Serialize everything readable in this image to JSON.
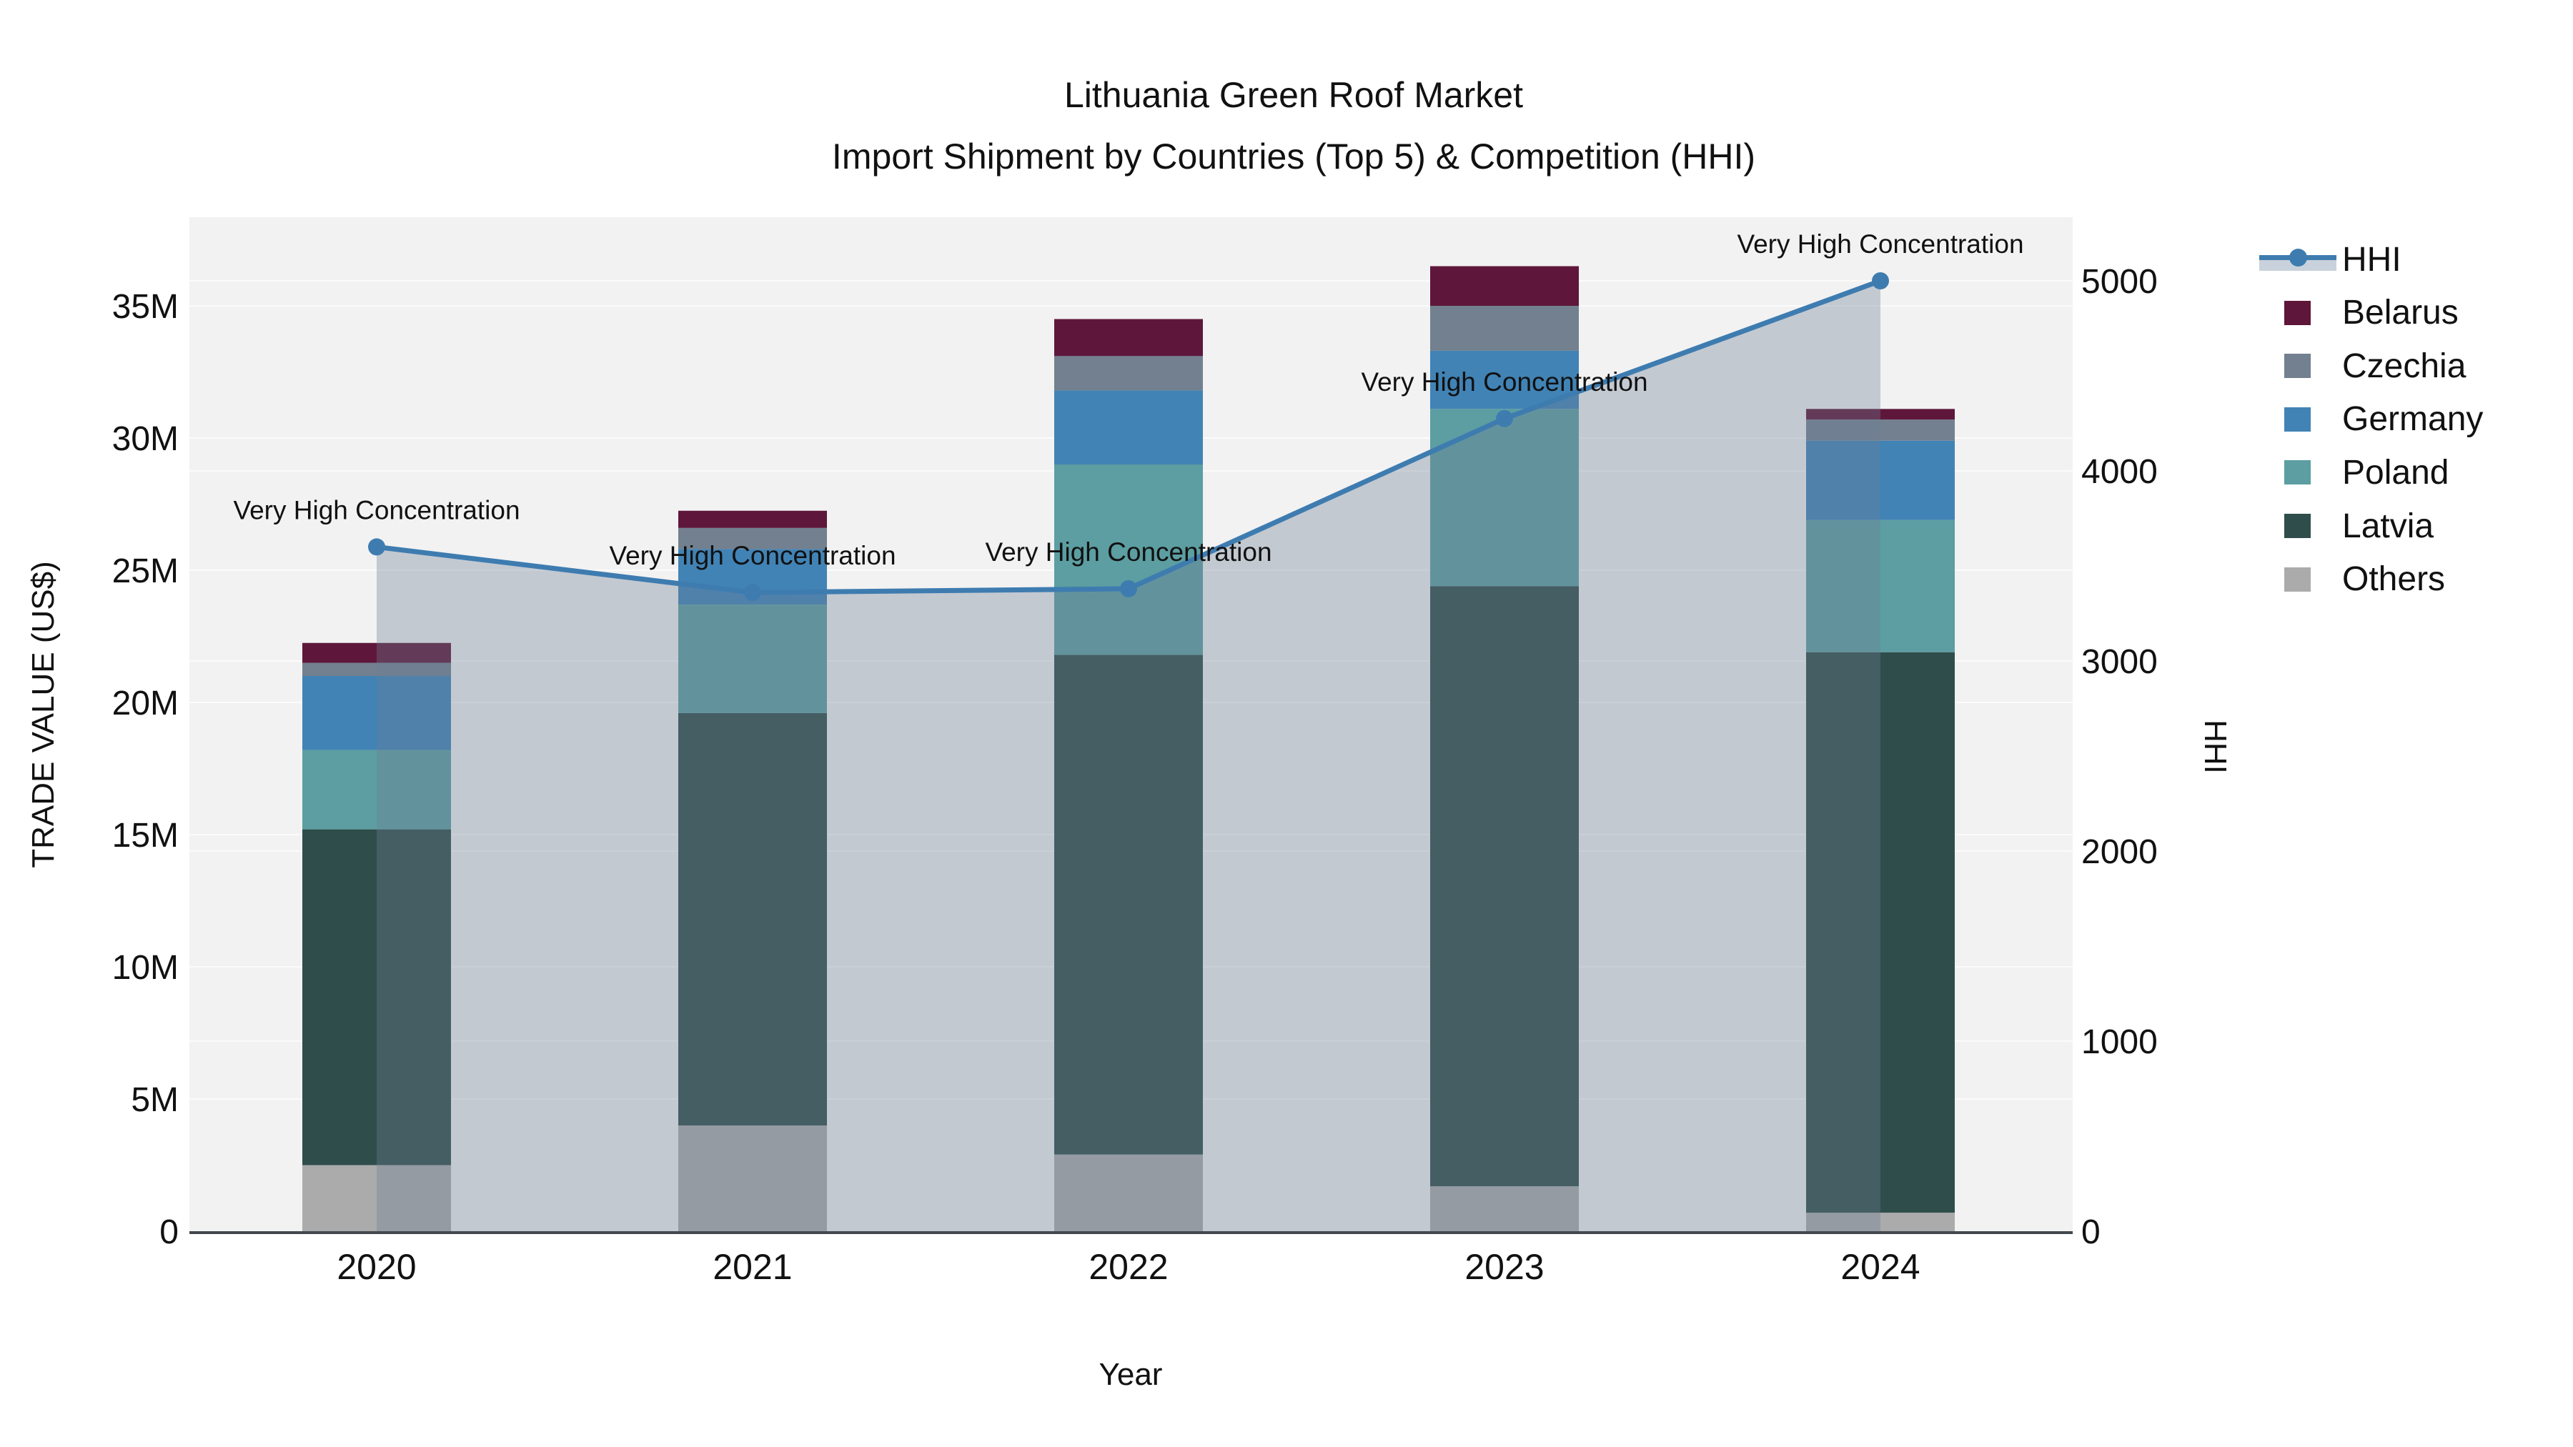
{
  "title": "Lithuania Green Roof Market",
  "subtitle": "Import Shipment by Countries (Top 5) & Competition (HHI)",
  "chart_data": {
    "type": "bar",
    "subtype": "stacked-bars-with-line-overlay",
    "categories": [
      "2020",
      "2021",
      "2022",
      "2023",
      "2024"
    ],
    "xlabel": "Year",
    "ylabel_left": "TRADE VALUE (US$)",
    "ylabel_right": "HHI",
    "ylim_left_musd": [
      0,
      38.3
    ],
    "ylim_right": [
      0,
      5335
    ],
    "grid": true,
    "legend_position": "right",
    "stack_note": "series listed bottom-to-top of the stack; values in millions of US$",
    "series": [
      {
        "name": "Others",
        "color": "#ABABAB",
        "values_musd": [
          2.5,
          4.0,
          2.9,
          1.7,
          0.7
        ]
      },
      {
        "name": "Latvia",
        "color": "#2F4D4B",
        "values_musd": [
          12.7,
          15.6,
          18.9,
          22.7,
          21.2
        ]
      },
      {
        "name": "Poland",
        "color": "#5C9EA1",
        "values_musd": [
          3.0,
          4.1,
          7.2,
          6.7,
          5.0
        ]
      },
      {
        "name": "Germany",
        "color": "#4183B5",
        "values_musd": [
          2.8,
          2.1,
          2.8,
          2.2,
          3.0
        ]
      },
      {
        "name": "Czechia",
        "color": "#72808F",
        "values_musd": [
          0.5,
          0.8,
          1.3,
          1.7,
          0.8
        ]
      },
      {
        "name": "Belarus",
        "color": "#5E173A",
        "values_musd": [
          0.75,
          0.65,
          1.4,
          1.5,
          0.4
        ]
      }
    ],
    "bar_totals_musd": [
      22.25,
      27.25,
      34.5,
      36.5,
      31.1
    ],
    "hhi_line": {
      "name": "HHI",
      "color": "#3E7CB0",
      "area_fill": "rgba(108,125,149,0.35)",
      "values": [
        3600,
        3360,
        3380,
        4275,
        5000
      ]
    },
    "annotations": [
      {
        "x": "2020",
        "text": "Very High Concentration"
      },
      {
        "x": "2021",
        "text": "Very High Concentration"
      },
      {
        "x": "2022",
        "text": "Very High Concentration"
      },
      {
        "x": "2023",
        "text": "Very High Concentration"
      },
      {
        "x": "2024",
        "text": "Very High Concentration"
      }
    ],
    "yaxis_left_ticks": [
      {
        "value": 0,
        "label": "0"
      },
      {
        "value": 5,
        "label": "5M"
      },
      {
        "value": 10,
        "label": "10M"
      },
      {
        "value": 15,
        "label": "15M"
      },
      {
        "value": 20,
        "label": "20M"
      },
      {
        "value": 25,
        "label": "25M"
      },
      {
        "value": 30,
        "label": "30M"
      },
      {
        "value": 35,
        "label": "35M"
      }
    ],
    "yaxis_right_ticks": [
      {
        "value": 0,
        "label": "0"
      },
      {
        "value": 1000,
        "label": "1000"
      },
      {
        "value": 2000,
        "label": "2000"
      },
      {
        "value": 3000,
        "label": "3000"
      },
      {
        "value": 4000,
        "label": "4000"
      },
      {
        "value": 5000,
        "label": "5000"
      }
    ],
    "legend": [
      {
        "label": "HHI",
        "kind": "line"
      },
      {
        "label": "Belarus",
        "kind": "swatch",
        "color": "#5E173A"
      },
      {
        "label": "Czechia",
        "kind": "swatch",
        "color": "#72808F"
      },
      {
        "label": "Germany",
        "kind": "swatch",
        "color": "#4183B5"
      },
      {
        "label": "Poland",
        "kind": "swatch",
        "color": "#5C9EA1"
      },
      {
        "label": "Latvia",
        "kind": "swatch",
        "color": "#2F4D4B"
      },
      {
        "label": "Others",
        "kind": "swatch",
        "color": "#ABABAB"
      }
    ],
    "colors": {
      "plot_background": "#F2F2F2",
      "gridline": "#FBFBFB",
      "axis_line": "#42484D",
      "text": "#111111"
    }
  }
}
